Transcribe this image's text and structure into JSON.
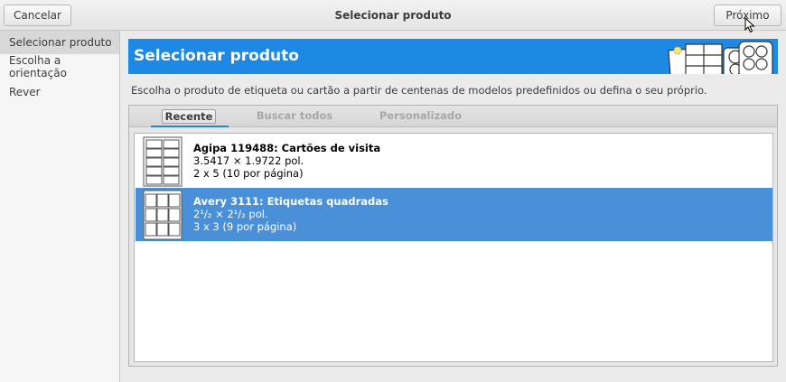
{
  "header": {
    "cancel_label": "Cancelar",
    "title": "Selecionar produto",
    "next_label": "Próximo"
  },
  "sidebar": {
    "items": [
      {
        "label": "Selecionar produto",
        "active": true
      },
      {
        "label": "Escolha a orientação",
        "active": false
      },
      {
        "label": "Rever",
        "active": false
      }
    ]
  },
  "main": {
    "banner_title": "Selecionar produto",
    "description": "Escolha o produto de etiqueta ou cartão a partir de centenas de modelos predefinidos ou defina o seu próprio.",
    "tabs": [
      {
        "label": "Recente",
        "active": true
      },
      {
        "label": "Buscar todos",
        "active": false
      },
      {
        "label": "Personalizado",
        "active": false
      }
    ],
    "products": [
      {
        "name": "Agipa 119488: Cartões de visita",
        "size": "3.5417 × 1.9722 pol.",
        "layout": "2 x 5  (10 por página)",
        "selected": false
      },
      {
        "name": "Avery 3111: Etiquetas quadradas",
        "size": "2¹/₂ × 2¹/₂ pol.",
        "layout": "3 x 3  (9 por página)",
        "selected": true
      }
    ]
  },
  "colors": {
    "accent": "#1e88e5",
    "selection": "#4a90d9"
  }
}
